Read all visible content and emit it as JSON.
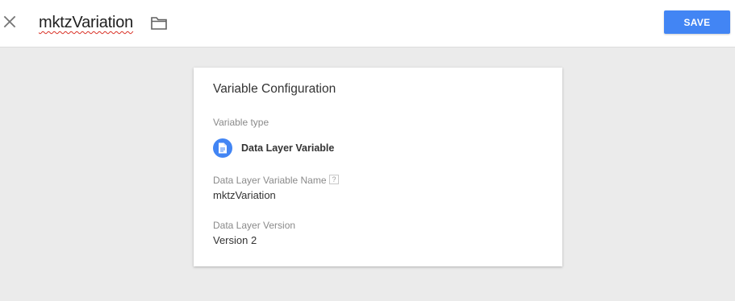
{
  "header": {
    "title": "mktzVariation",
    "save_label": "SAVE",
    "close_icon": "close-icon",
    "folder_icon": "folder-icon"
  },
  "card": {
    "title": "Variable Configuration",
    "variable_type_label": "Variable type",
    "variable_type_value": "Data Layer Variable",
    "variable_type_icon": "document-icon",
    "name_label": "Data Layer Variable Name",
    "name_help": "?",
    "name_value": "mktzVariation",
    "version_label": "Data Layer Version",
    "version_value": "Version 2"
  },
  "colors": {
    "accent": "#4285f4",
    "page_background": "#ebebeb",
    "header_background": "#ffffff",
    "spellcheck_underline": "#d93025"
  }
}
